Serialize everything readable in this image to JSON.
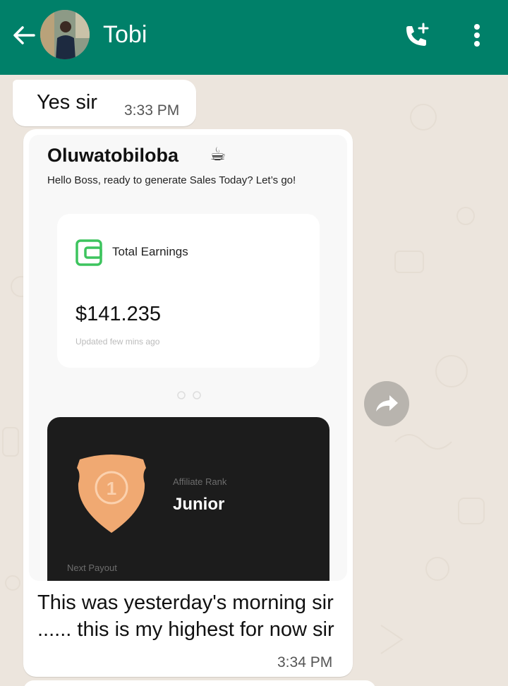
{
  "header": {
    "contact_name": "Tobi",
    "background": "#008069",
    "icons": {
      "back": "arrow-left-icon",
      "call": "add-call-icon",
      "menu": "more-vertical-icon"
    }
  },
  "messages": [
    {
      "text": "Yes sir",
      "time": "3:33 PM"
    },
    {
      "image": {
        "name": "Oluwatobiloba",
        "emoji": "☕",
        "greeting": "Hello Boss, ready to generate Sales Today? Let’s go!",
        "earnings_label": "Total Earnings",
        "earnings_amount": "$141.235",
        "updated_text": "Updated few mins ago",
        "rank_label": "Affiliate Rank",
        "rank_value": "Junior",
        "rank_badge_number": "1",
        "payout_label": "Next Payout"
      },
      "caption": "This was yesterday's morning sir ...... this is my highest for now sir",
      "time": "3:34 PM"
    }
  ],
  "colors": {
    "wallet_green": "#3dc45e",
    "badge_orange": "#f0a972",
    "chat_bg": "#ece5dd"
  }
}
